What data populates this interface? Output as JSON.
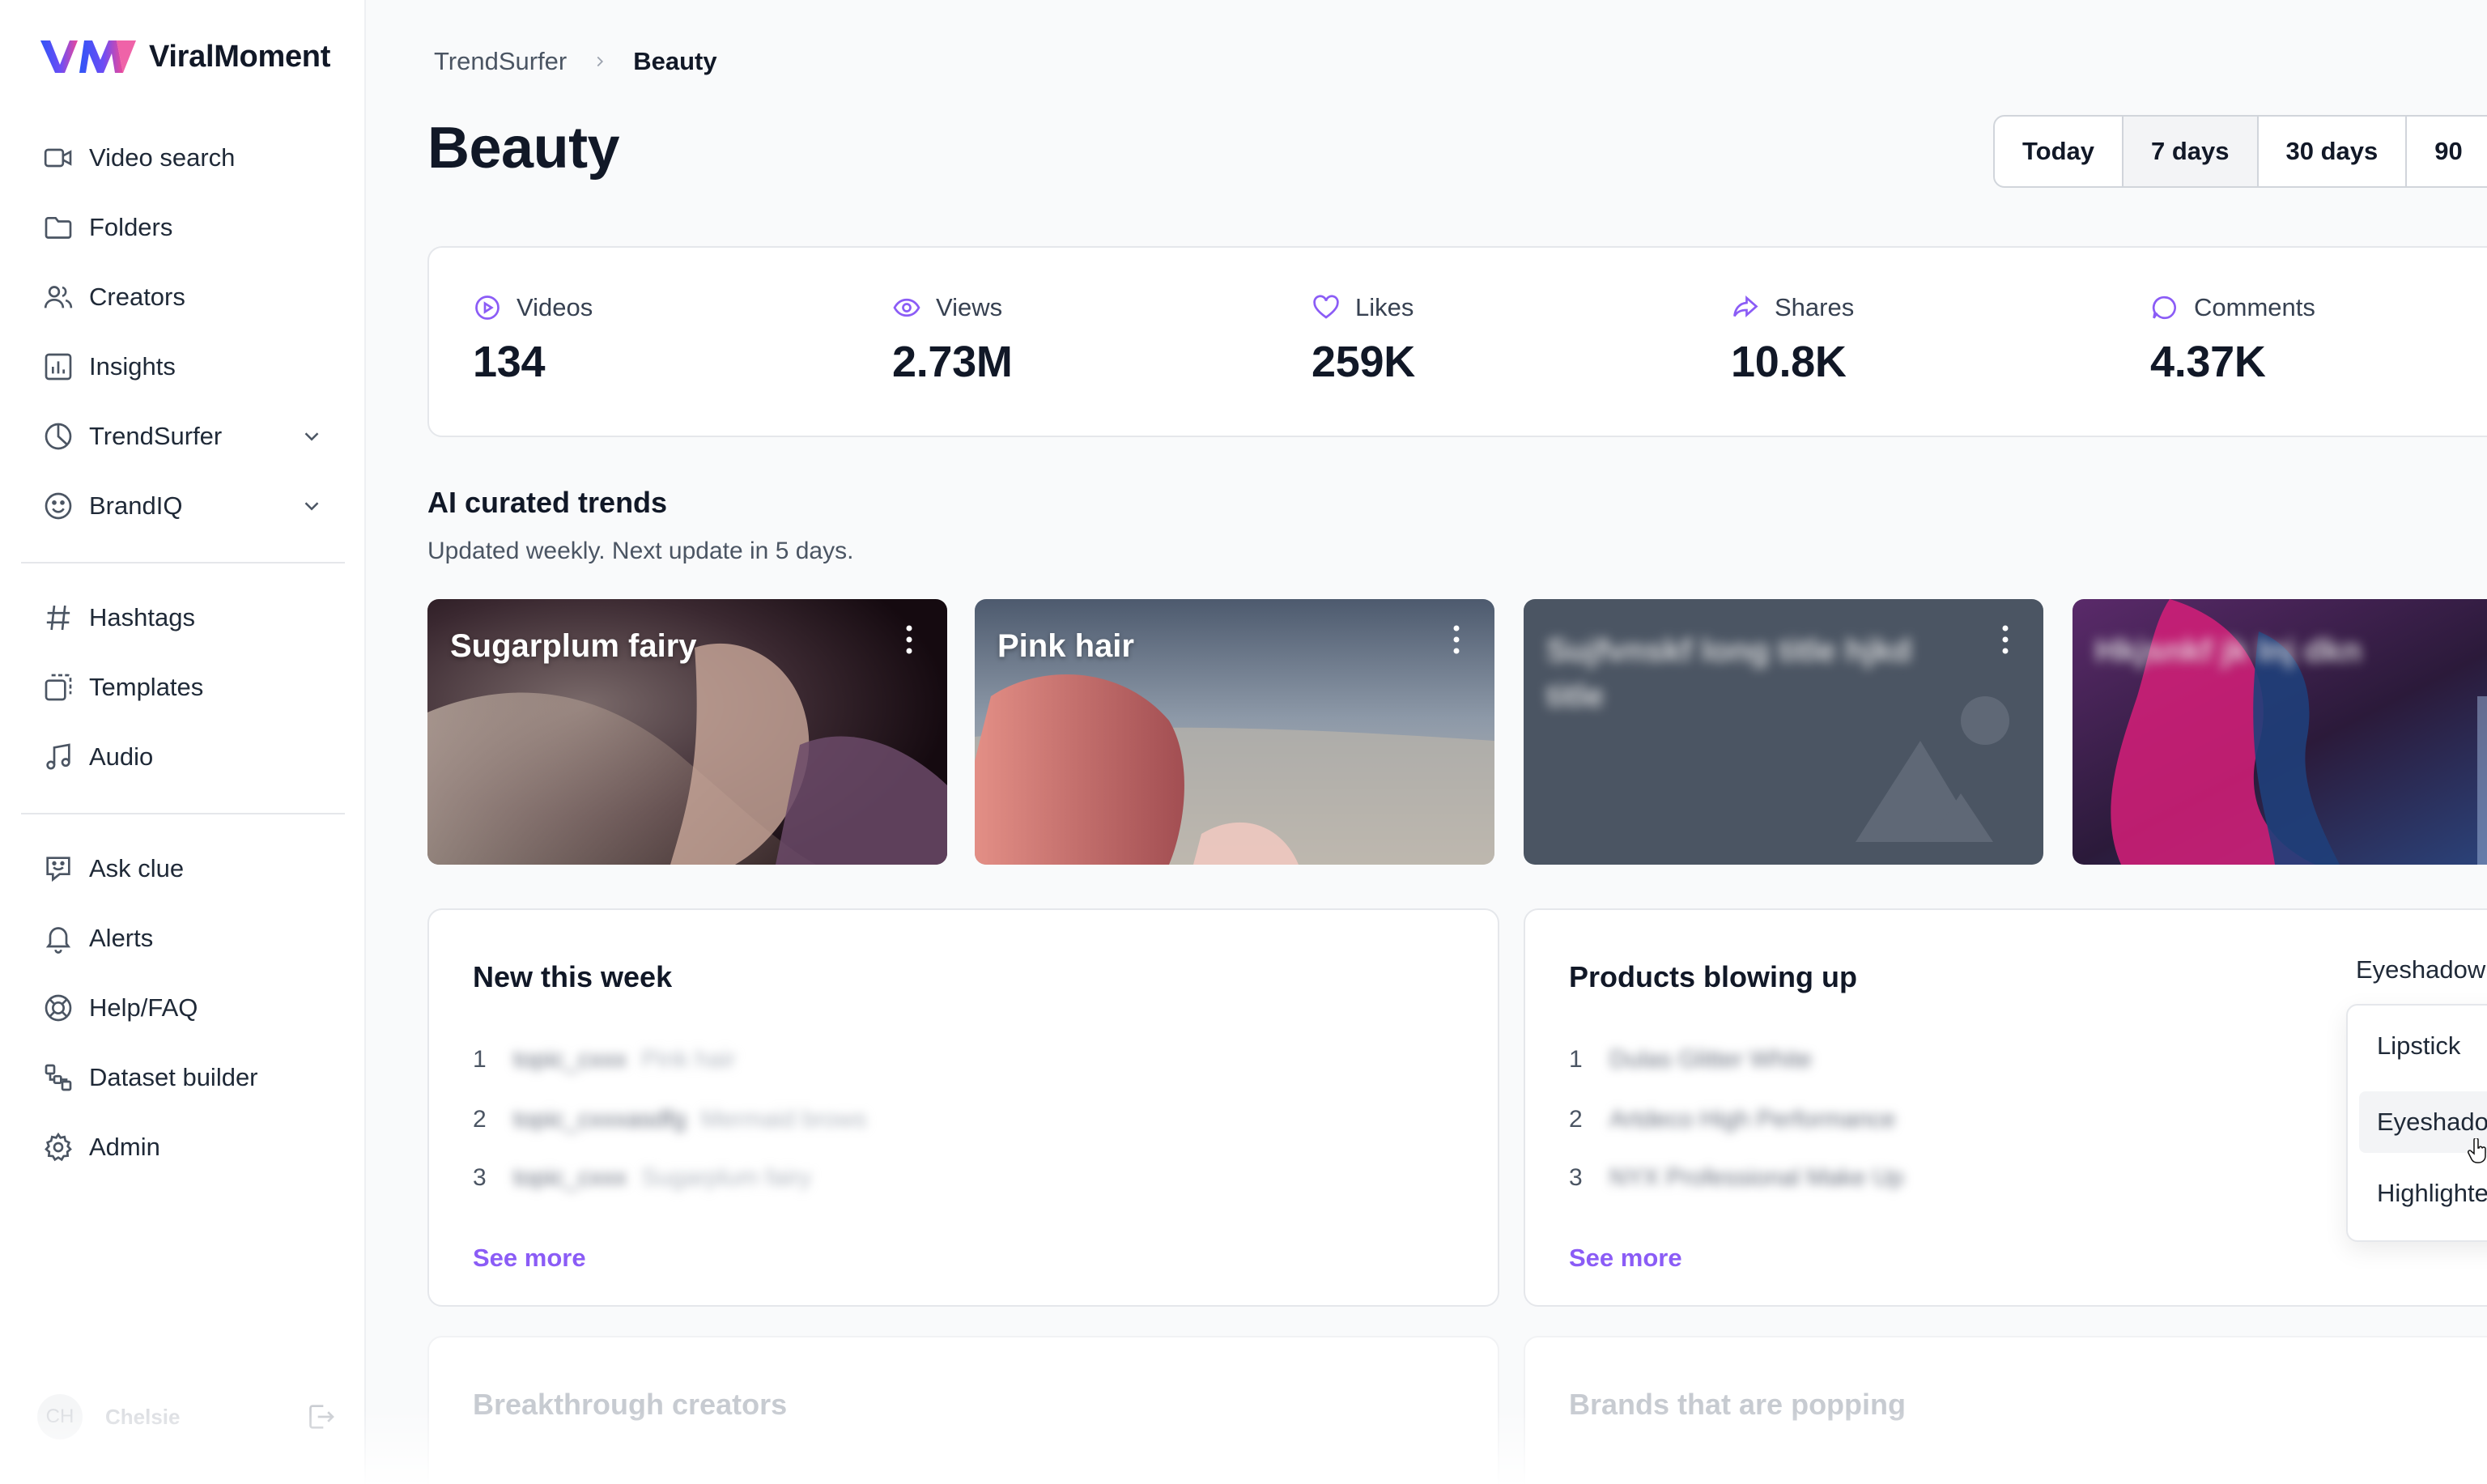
{
  "app": {
    "name": "ViralMoment"
  },
  "colors": {
    "accent": "#8b5cf6",
    "brand_blue": "#3b5bfd",
    "brand_pink": "#ec4899"
  },
  "sidebar": {
    "items": [
      {
        "label": "Video search",
        "icon": "video-icon"
      },
      {
        "label": "Folders",
        "icon": "folder-icon"
      },
      {
        "label": "Creators",
        "icon": "users-icon"
      },
      {
        "label": "Insights",
        "icon": "bar-chart-icon"
      },
      {
        "label": "TrendSurfer",
        "icon": "pie-chart-icon",
        "expandable": true
      },
      {
        "label": "BrandIQ",
        "icon": "smile-icon",
        "expandable": true
      },
      {
        "label": "Hashtags",
        "icon": "hash-icon"
      },
      {
        "label": "Templates",
        "icon": "templates-icon"
      },
      {
        "label": "Audio",
        "icon": "music-icon"
      },
      {
        "label": "Ask clue",
        "icon": "chat-icon"
      },
      {
        "label": "Alerts",
        "icon": "bell-icon"
      },
      {
        "label": "Help/FAQ",
        "icon": "lifebuoy-icon"
      },
      {
        "label": "Dataset builder",
        "icon": "dataset-icon"
      },
      {
        "label": "Admin",
        "icon": "gear-icon"
      }
    ],
    "user": {
      "initials": "CH",
      "name": "Chelsie"
    }
  },
  "breadcrumb": {
    "parent": "TrendSurfer",
    "current": "Beauty"
  },
  "page": {
    "title": "Beauty"
  },
  "date_range": {
    "options": [
      "Today",
      "7 days",
      "30 days",
      "90"
    ],
    "selected": "7 days"
  },
  "stats": [
    {
      "label": "Videos",
      "value": "134",
      "icon": "play-circle-icon"
    },
    {
      "label": "Views",
      "value": "2.73M",
      "icon": "eye-icon"
    },
    {
      "label": "Likes",
      "value": "259K",
      "icon": "heart-icon"
    },
    {
      "label": "Shares",
      "value": "10.8K",
      "icon": "share-icon"
    },
    {
      "label": "Comments",
      "value": "4.37K",
      "icon": "comment-icon"
    }
  ],
  "trends": {
    "title": "AI curated trends",
    "subtitle": "Updated weekly. Next update in 5 days.",
    "cards": [
      {
        "title": "Sugarplum fairy"
      },
      {
        "title": "Pink hair"
      },
      {
        "title": "Sujfvnskf long title hjkd title"
      },
      {
        "title": "Hkjsnkf jk lnj dkn"
      }
    ]
  },
  "new_this_week": {
    "title": "New this week",
    "rows": [
      {
        "rank": "1",
        "tag": "topic_cxxx",
        "desc": "Pink hair"
      },
      {
        "rank": "2",
        "tag": "topic_cxxxasdfg",
        "desc": "Mermaid brows"
      },
      {
        "rank": "3",
        "tag": "topic_cxxx",
        "desc": "Sugarplum fairy"
      }
    ],
    "see_more": "See more"
  },
  "products": {
    "title": "Products blowing up",
    "rows": [
      {
        "rank": "1",
        "name": "Dulas Glitter White"
      },
      {
        "rank": "2",
        "name": "Artdeco High Performance"
      },
      {
        "rank": "3",
        "name": "NYX Professional Make Up"
      }
    ],
    "see_more": "See more",
    "dropdown": {
      "selected": "Eyeshadow",
      "options": [
        "Lipstick",
        "Eyeshadow",
        "Highlighter"
      ]
    }
  },
  "lower_panels": {
    "left_title": "Breakthrough creators",
    "right_title": "Brands that are popping"
  }
}
